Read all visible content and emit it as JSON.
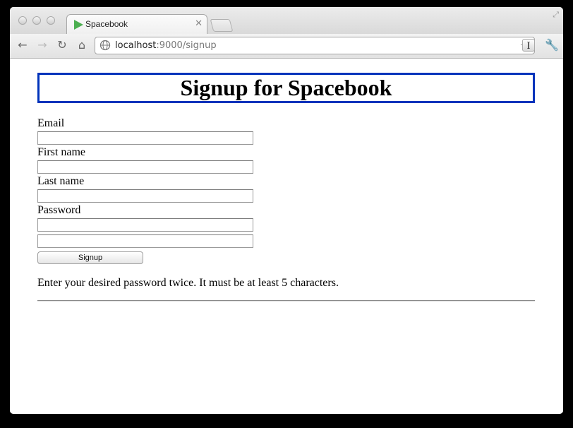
{
  "browser": {
    "tab_title": "Spacebook",
    "url_host": "localhost",
    "url_rest": ":9000/signup",
    "extension_label": "I"
  },
  "page": {
    "heading": "Signup for Spacebook",
    "form": {
      "email_label": "Email",
      "first_name_label": "First name",
      "last_name_label": "Last name",
      "password_label": "Password",
      "email_value": "",
      "first_name_value": "",
      "last_name_value": "",
      "password_value": "",
      "password_confirm_value": "",
      "submit_label": "Signup"
    },
    "hint": "Enter your desired password twice. It must be at least 5 characters."
  },
  "colors": {
    "heading_border": "#0033bb",
    "favicon": "#4caf50"
  }
}
